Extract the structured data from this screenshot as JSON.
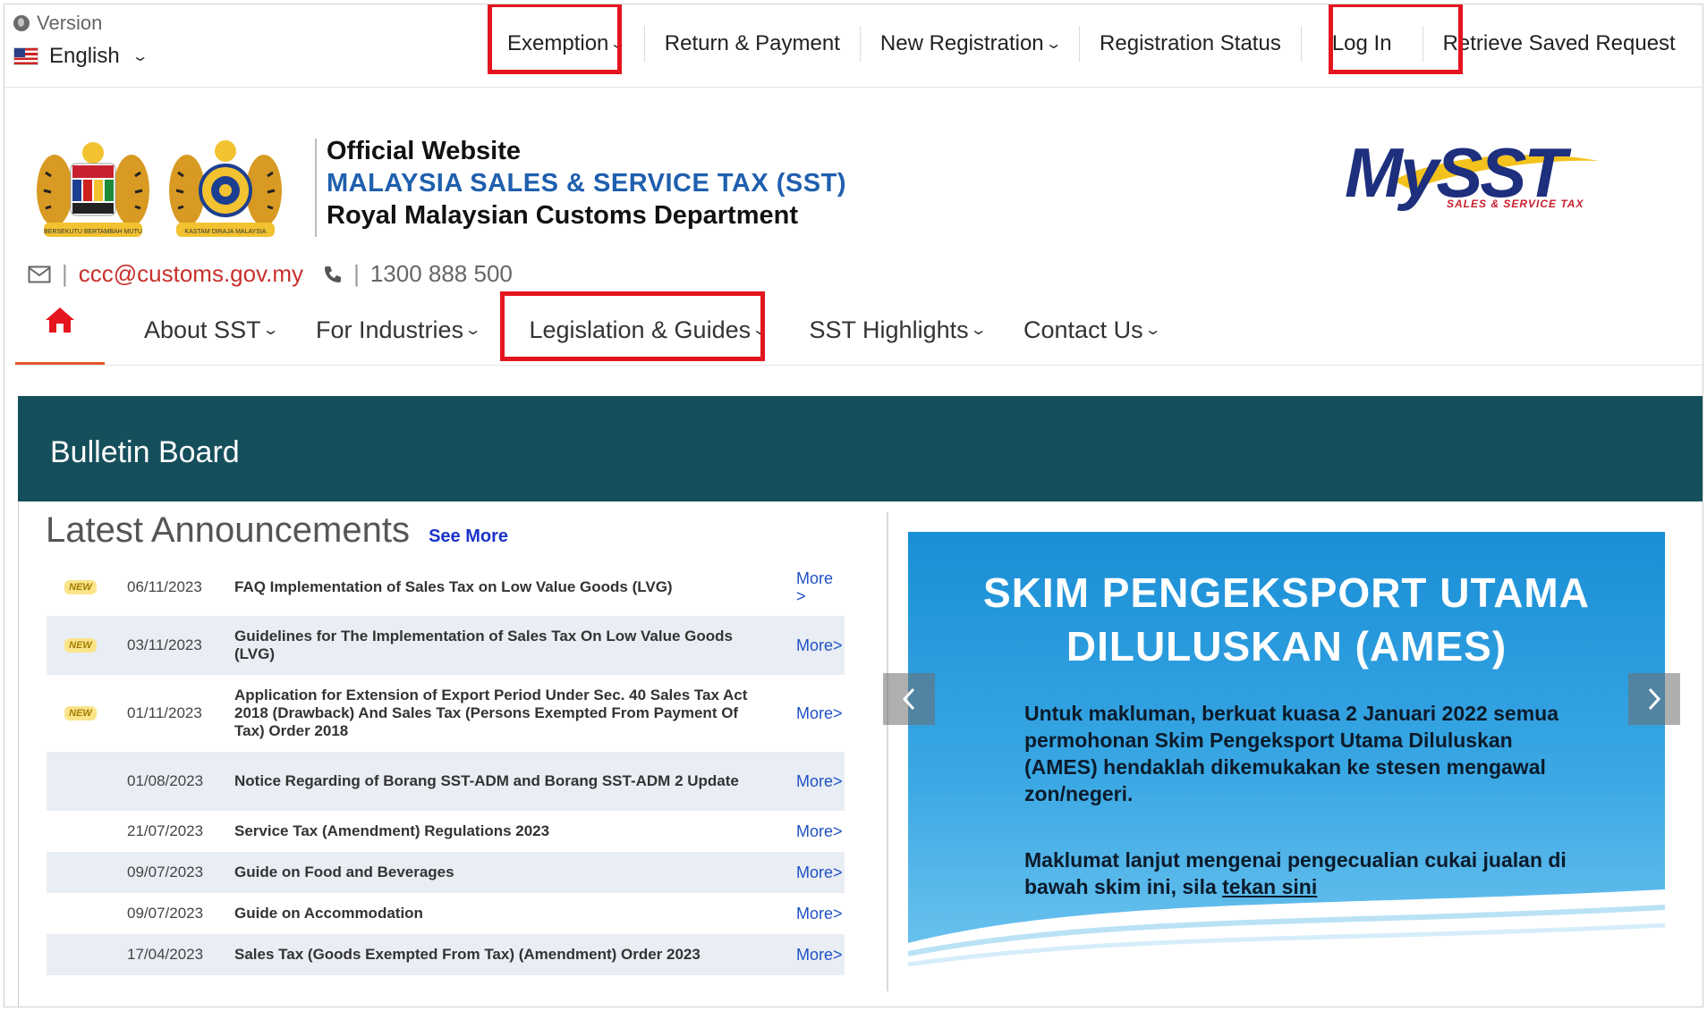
{
  "topbar": {
    "version_label": "Version",
    "language": "English",
    "nav": [
      "Exemption",
      "Return & Payment",
      "New Registration",
      "Registration Status",
      "Log In",
      "Retrieve Saved Request"
    ]
  },
  "header": {
    "title_line1": "Official Website",
    "title_line2": "MALAYSIA SALES & SERVICE TAX (SST)",
    "title_line3": "Royal Malaysian Customs Department",
    "logo_text": "MySST",
    "logo_subtext": "SALES & SERVICE TAX",
    "email": "ccc@customs.gov.my",
    "phone": "1300 888 500",
    "crest1_text": "BERSEKUTU BERTAMBAH MUTU",
    "crest2_text": "KASTAM DIRAJA MALAYSIA"
  },
  "mainnav": [
    "About SST",
    "For Industries",
    "Legislation & Guides",
    "SST Highlights",
    "Contact Us"
  ],
  "bulletin": {
    "title": "Bulletin Board",
    "heading": "Latest Announcements",
    "see_more": "See More",
    "badge": "NEW",
    "rows": [
      {
        "date": "06/11/2023",
        "text": "FAQ Implementation of Sales Tax on Low Value Goods (LVG)",
        "more": "More >"
      },
      {
        "date": "03/11/2023",
        "text": "Guidelines for The Implementation of Sales Tax On Low Value Goods (LVG)",
        "more": "More>"
      },
      {
        "date": "01/11/2023",
        "text": "Application for Extension of Export Period Under Sec. 40 Sales Tax Act 2018 (Drawback) And Sales Tax (Persons Exempted From Payment Of Tax) Order 2018",
        "more": "More>"
      },
      {
        "date": "01/08/2023",
        "text": "Notice Regarding of Borang SST-ADM and Borang SST-ADM 2 Update",
        "more": "More>"
      },
      {
        "date": "21/07/2023",
        "text": "Service Tax (Amendment) Regulations 2023",
        "more": "More>"
      },
      {
        "date": "09/07/2023",
        "text": "Guide on Food and Beverages",
        "more": "More>"
      },
      {
        "date": "09/07/2023",
        "text": "Guide on Accommodation",
        "more": "More>"
      },
      {
        "date": "17/04/2023",
        "text": "Sales Tax (Goods Exempted From Tax) (Amendment) Order 2023",
        "more": "More>"
      }
    ]
  },
  "slide": {
    "title_line1": "SKIM PENGEKSPORT UTAMA",
    "title_line2": "DILULUSKAN (AMES)",
    "para1": "Untuk makluman, berkuat kuasa 2 Januari 2022 semua permohonan Skim Pengeksport Utama Diluluskan (AMES) hendaklah dikemukakan ke stesen mengawal zon/negeri.",
    "para2_text": "Maklumat lanjut mengenai pengecualian cukai jualan di bawah skim ini, sila",
    "para2_link": "tekan sini"
  },
  "colors": {
    "highlight": "#e4151f",
    "bulletin_bg": "#164f5c",
    "link": "#1f52c4",
    "email": "#c9302c"
  }
}
